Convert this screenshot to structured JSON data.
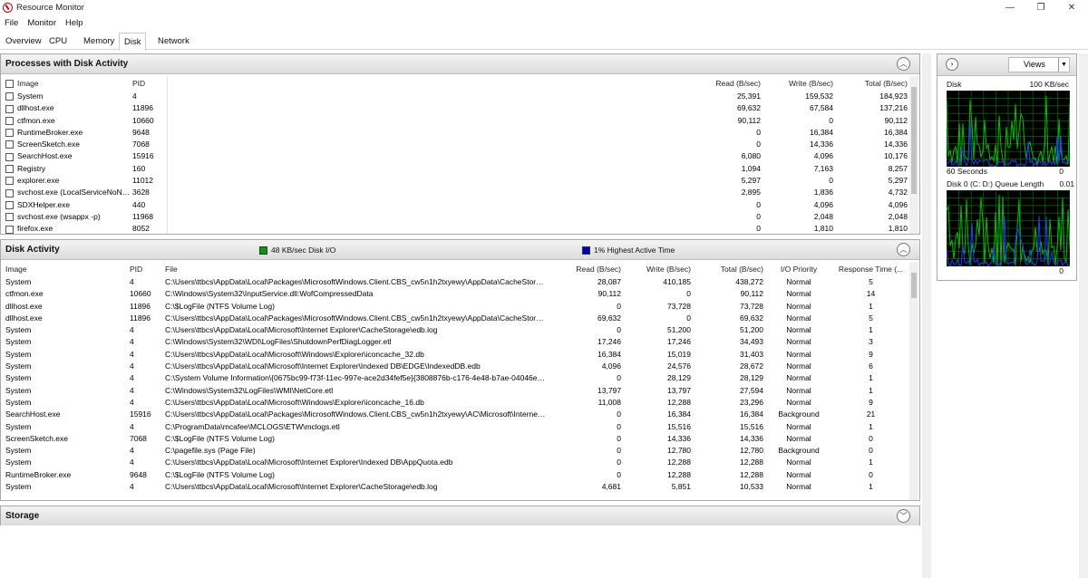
{
  "window": {
    "title": "Resource Monitor",
    "minimize": "—",
    "maximize": "❐",
    "close": "✕"
  },
  "menu": [
    "File",
    "Monitor",
    "Help"
  ],
  "tabs": [
    {
      "label": "Overview"
    },
    {
      "label": "CPU"
    },
    {
      "label": "Memory"
    },
    {
      "label": "Disk",
      "active": true
    },
    {
      "label": "Network"
    }
  ],
  "processes": {
    "title": "Processes with Disk Activity",
    "columns": [
      "Image",
      "PID",
      "Read (B/sec)",
      "Write (B/sec)",
      "Total (B/sec)"
    ],
    "rows": [
      {
        "image": "System",
        "pid": "4",
        "read": "25,391",
        "write": "159,532",
        "total": "184,923"
      },
      {
        "image": "dllhost.exe",
        "pid": "11896",
        "read": "69,632",
        "write": "67,584",
        "total": "137,216"
      },
      {
        "image": "ctfmon.exe",
        "pid": "10660",
        "read": "90,112",
        "write": "0",
        "total": "90,112"
      },
      {
        "image": "RuntimeBroker.exe",
        "pid": "9648",
        "read": "0",
        "write": "16,384",
        "total": "16,384"
      },
      {
        "image": "ScreenSketch.exe",
        "pid": "7068",
        "read": "0",
        "write": "14,336",
        "total": "14,336"
      },
      {
        "image": "SearchHost.exe",
        "pid": "15916",
        "read": "6,080",
        "write": "4,096",
        "total": "10,176"
      },
      {
        "image": "Registry",
        "pid": "160",
        "read": "1,094",
        "write": "7,163",
        "total": "8,257"
      },
      {
        "image": "explorer.exe",
        "pid": "11012",
        "read": "5,297",
        "write": "0",
        "total": "5,297"
      },
      {
        "image": "svchost.exe (LocalServiceNoNet...",
        "pid": "3628",
        "read": "2,895",
        "write": "1,836",
        "total": "4,732"
      },
      {
        "image": "SDXHelper.exe",
        "pid": "440",
        "read": "0",
        "write": "4,096",
        "total": "4,096"
      },
      {
        "image": "svchost.exe (wsappx -p)",
        "pid": "11968",
        "read": "0",
        "write": "2,048",
        "total": "2,048"
      },
      {
        "image": "firefox.exe",
        "pid": "8052",
        "read": "0",
        "write": "1,810",
        "total": "1,810"
      }
    ]
  },
  "disk_activity": {
    "title": "Disk Activity",
    "legend_io": "48 KB/sec Disk I/O",
    "legend_active": "1% Highest Active Time",
    "legend_io_color": "#00a000",
    "legend_active_color": "#0000c0",
    "columns": [
      "Image",
      "PID",
      "File",
      "Read (B/sec)",
      "Write (B/sec)",
      "Total (B/sec)",
      "I/O Priority",
      "Response Time (..."
    ],
    "rows": [
      {
        "image": "System",
        "pid": "4",
        "file": "C:\\Users\\ttbcs\\AppData\\Local\\Packages\\MicrosoftWindows.Client.CBS_cw5n1h2txyewy\\AppData\\CacheStorage\\C...",
        "read": "28,087",
        "write": "410,185",
        "total": "438,272",
        "priority": "Normal",
        "response": "5"
      },
      {
        "image": "ctfmon.exe",
        "pid": "10660",
        "file": "C:\\Windows\\System32\\InputService.dll:WofCompressedData",
        "read": "90,112",
        "write": "0",
        "total": "90,112",
        "priority": "Normal",
        "response": "14"
      },
      {
        "image": "dllhost.exe",
        "pid": "11896",
        "file": "C:\\$LogFile (NTFS Volume Log)",
        "read": "0",
        "write": "73,728",
        "total": "73,728",
        "priority": "Normal",
        "response": "1"
      },
      {
        "image": "dllhost.exe",
        "pid": "11896",
        "file": "C:\\Users\\ttbcs\\AppData\\Local\\Packages\\MicrosoftWindows.Client.CBS_cw5n1h2txyewy\\AppData\\CacheStorage\\C...",
        "read": "69,632",
        "write": "0",
        "total": "69,632",
        "priority": "Normal",
        "response": "5"
      },
      {
        "image": "System",
        "pid": "4",
        "file": "C:\\Users\\ttbcs\\AppData\\Local\\Microsoft\\Internet Explorer\\CacheStorage\\edb.log",
        "read": "0",
        "write": "51,200",
        "total": "51,200",
        "priority": "Normal",
        "response": "1"
      },
      {
        "image": "System",
        "pid": "4",
        "file": "C:\\Windows\\System32\\WDI\\LogFiles\\ShutdownPerfDiagLogger.etl",
        "read": "17,246",
        "write": "17,246",
        "total": "34,493",
        "priority": "Normal",
        "response": "3"
      },
      {
        "image": "System",
        "pid": "4",
        "file": "C:\\Users\\ttbcs\\AppData\\Local\\Microsoft\\Windows\\Explorer\\iconcache_32.db",
        "read": "16,384",
        "write": "15,019",
        "total": "31,403",
        "priority": "Normal",
        "response": "9"
      },
      {
        "image": "System",
        "pid": "4",
        "file": "C:\\Users\\ttbcs\\AppData\\Local\\Microsoft\\Internet Explorer\\Indexed DB\\EDGE\\IndexedDB.edb",
        "read": "4,096",
        "write": "24,576",
        "total": "28,672",
        "priority": "Normal",
        "response": "6"
      },
      {
        "image": "System",
        "pid": "4",
        "file": "C:\\System Volume Information\\{0675bc99-f73f-11ec-997e-ace2d34fef5e}{3808876b-c176-4e48-b7ae-04046e6...",
        "read": "0",
        "write": "28,129",
        "total": "28,129",
        "priority": "Normal",
        "response": "1"
      },
      {
        "image": "System",
        "pid": "4",
        "file": "C:\\Windows\\System32\\LogFiles\\WMI\\NetCore.etl",
        "read": "13,797",
        "write": "13,797",
        "total": "27,594",
        "priority": "Normal",
        "response": "1"
      },
      {
        "image": "System",
        "pid": "4",
        "file": "C:\\Users\\ttbcs\\AppData\\Local\\Microsoft\\Windows\\Explorer\\iconcache_16.db",
        "read": "11,008",
        "write": "12,288",
        "total": "23,296",
        "priority": "Normal",
        "response": "9"
      },
      {
        "image": "SearchHost.exe",
        "pid": "15916",
        "file": "C:\\Users\\ttbcs\\AppData\\Local\\Packages\\MicrosoftWindows.Client.CBS_cw5n1h2txyewy\\AC\\Microsoft\\Internet Exp...",
        "read": "0",
        "write": "16,384",
        "total": "16,384",
        "priority": "Background",
        "response": "21"
      },
      {
        "image": "System",
        "pid": "4",
        "file": "C:\\ProgramData\\mcafee\\MCLOGS\\ETW\\mclogs.etl",
        "read": "0",
        "write": "15,516",
        "total": "15,516",
        "priority": "Normal",
        "response": "1"
      },
      {
        "image": "ScreenSketch.exe",
        "pid": "7068",
        "file": "C:\\$LogFile (NTFS Volume Log)",
        "read": "0",
        "write": "14,336",
        "total": "14,336",
        "priority": "Normal",
        "response": "0"
      },
      {
        "image": "System",
        "pid": "4",
        "file": "C:\\pagefile.sys (Page File)",
        "read": "0",
        "write": "12,780",
        "total": "12,780",
        "priority": "Background",
        "response": "0"
      },
      {
        "image": "System",
        "pid": "4",
        "file": "C:\\Users\\ttbcs\\AppData\\Local\\Microsoft\\Internet Explorer\\Indexed DB\\AppQuota.edb",
        "read": "0",
        "write": "12,288",
        "total": "12,288",
        "priority": "Normal",
        "response": "1"
      },
      {
        "image": "RuntimeBroker.exe",
        "pid": "9648",
        "file": "C:\\$LogFile (NTFS Volume Log)",
        "read": "0",
        "write": "12,288",
        "total": "12,288",
        "priority": "Normal",
        "response": "0"
      },
      {
        "image": "System",
        "pid": "4",
        "file": "C:\\Users\\ttbcs\\AppData\\Local\\Microsoft\\Internet Explorer\\CacheStorage\\edb.log",
        "read": "4,681",
        "write": "5,851",
        "total": "10,533",
        "priority": "Normal",
        "response": "1"
      }
    ]
  },
  "storage": {
    "title": "Storage"
  },
  "side_panel": {
    "views_label": "Views",
    "graph1": {
      "left_label": "Disk",
      "right_label": "100 KB/sec",
      "bottom_left": "60 Seconds",
      "bottom_right": "0"
    },
    "graph2": {
      "left_label": "Disk 0 (C: D:) Queue Length",
      "right_label": "0.01",
      "bottom_right": "0"
    },
    "grid_color": "#008000",
    "line_green": "#00c000",
    "line_blue": "#2040ff"
  }
}
